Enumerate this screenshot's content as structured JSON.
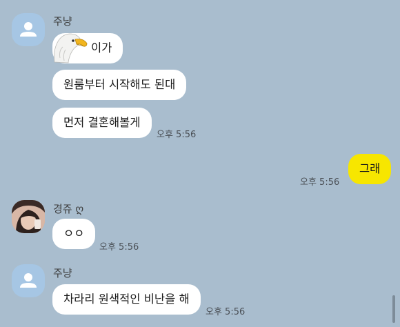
{
  "messages": [
    {
      "sender": "주냥",
      "lines": [
        "이가",
        "원룸부터 시작해도 된대",
        "먼저 결혼해볼게"
      ],
      "time": "오후 5:56",
      "sticker": "eagle-emoticon"
    },
    {
      "mine": true,
      "lines": [
        "그래"
      ],
      "time": "오후 5:56"
    },
    {
      "sender": "경쥬 ღ",
      "lines": [
        "ㅇㅇ"
      ],
      "time": "오후 5:56"
    },
    {
      "sender": "주냥",
      "lines": [
        "차라리 원색적인 비난을 해"
      ],
      "time": "오후 5:56"
    }
  ],
  "colors": {
    "background": "#a9bdce",
    "incoming_bubble": "#ffffff",
    "outgoing_bubble": "#f7e600",
    "default_avatar": "#a6c6e4"
  }
}
